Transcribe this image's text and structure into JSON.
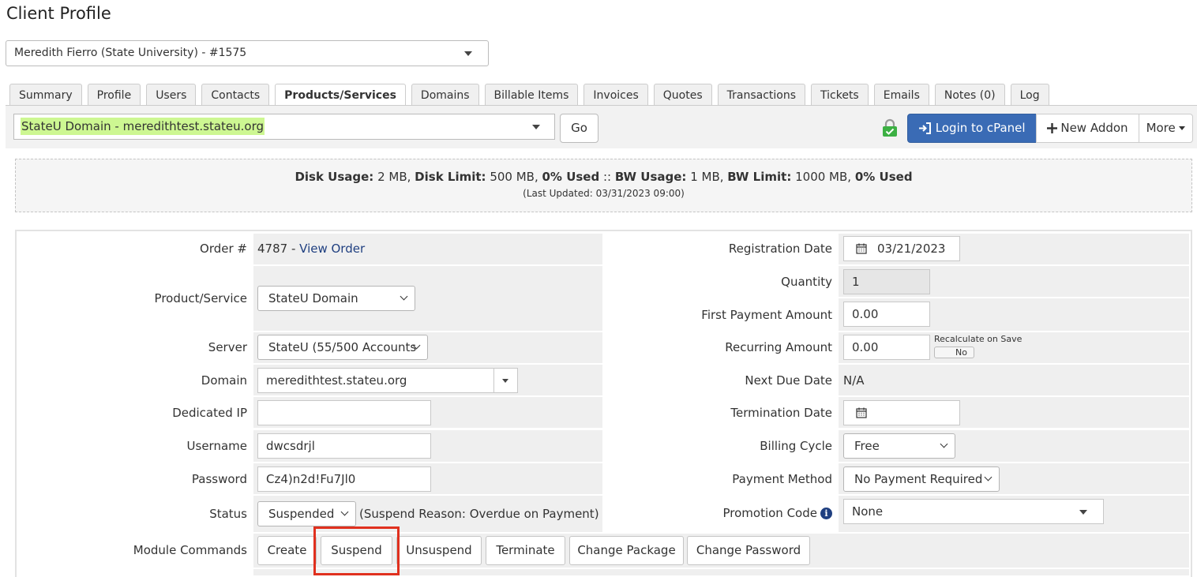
{
  "page": {
    "title": "Client Profile"
  },
  "client_selector": {
    "value": "Meredith Fierro (State University) - #1575"
  },
  "tabs": [
    {
      "label": "Summary"
    },
    {
      "label": "Profile"
    },
    {
      "label": "Users"
    },
    {
      "label": "Contacts"
    },
    {
      "label": "Products/Services"
    },
    {
      "label": "Domains"
    },
    {
      "label": "Billable Items"
    },
    {
      "label": "Invoices"
    },
    {
      "label": "Quotes"
    },
    {
      "label": "Transactions"
    },
    {
      "label": "Tickets"
    },
    {
      "label": "Emails"
    },
    {
      "label": "Notes (0)"
    },
    {
      "label": "Log"
    }
  ],
  "active_tab": "Products/Services",
  "service_bar": {
    "selected_service": "StateU Domain - meredithtest.stateu.org",
    "go_label": "Go",
    "login_label": "Login to cPanel",
    "new_addon_label": "New Addon",
    "more_label": "More"
  },
  "usage": {
    "disk_usage_label": "Disk Usage:",
    "disk_usage": "2 MB",
    "disk_limit_label": "Disk Limit:",
    "disk_limit": "500 MB",
    "disk_pct": "0% Used",
    "sep": "::",
    "bw_usage_label": "BW Usage:",
    "bw_usage": "1 MB",
    "bw_limit_label": "BW Limit:",
    "bw_limit": "1000 MB",
    "bw_pct": "0% Used",
    "last_updated": "(Last Updated: 03/31/2023 09:00)"
  },
  "form": {
    "order": {
      "label": "Order #",
      "number": "4787",
      "separator": " - ",
      "link": "View Order"
    },
    "product": {
      "label": "Product/Service",
      "value": "StateU Domain"
    },
    "server": {
      "label": "Server",
      "value": "StateU (55/500 Accounts"
    },
    "domain": {
      "label": "Domain",
      "value": "meredithtest.stateu.org"
    },
    "dedicated_ip": {
      "label": "Dedicated IP",
      "value": ""
    },
    "username": {
      "label": "Username",
      "value": "dwcsdrjl"
    },
    "password": {
      "label": "Password",
      "value": "Cz4)n2d!Fu7Jl0"
    },
    "status": {
      "label": "Status",
      "value": "Suspended",
      "reason": "(Suspend Reason: Overdue on Payment)"
    },
    "module_commands": {
      "label": "Module Commands",
      "buttons": [
        "Create",
        "Suspend",
        "Unsuspend",
        "Terminate",
        "Change Package",
        "Change Password"
      ]
    },
    "registration_date": {
      "label": "Registration Date",
      "value": "03/21/2023"
    },
    "quantity": {
      "label": "Quantity",
      "value": "1"
    },
    "first_payment": {
      "label": "First Payment Amount",
      "value": "0.00"
    },
    "recurring": {
      "label": "Recurring Amount",
      "value": "0.00",
      "recalc_label": "Recalculate on Save",
      "recalc_value": "No"
    },
    "next_due": {
      "label": "Next Due Date",
      "value": "N/A"
    },
    "termination_date": {
      "label": "Termination Date",
      "value": ""
    },
    "billing_cycle": {
      "label": "Billing Cycle",
      "value": "Free"
    },
    "payment_method": {
      "label": "Payment Method",
      "value": "No Payment Required"
    },
    "promotion_code": {
      "label": "Promotion Code",
      "value": "None"
    }
  },
  "colors": {
    "primary_button": "#3a6bb5",
    "highlight": "#cdf792",
    "annotation_box": "#e0301e",
    "link": "#1f3f80"
  },
  "icons": [
    "chevron-down-icon",
    "lock-icon",
    "sign-in-icon",
    "plus-icon",
    "calendar-icon",
    "info-icon"
  ]
}
